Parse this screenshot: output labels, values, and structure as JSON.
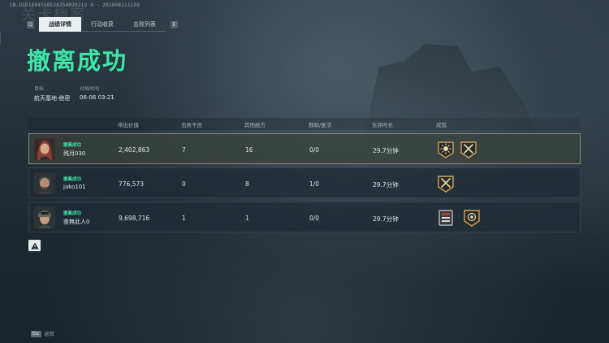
{
  "uid_text": "CN-UID1884558524254020213 4 - 202808111159",
  "ghost_title": "关卡档案",
  "tabs": {
    "left_key": "Q",
    "right_key": "E",
    "items": [
      {
        "label": "战绩详情",
        "active": true
      },
      {
        "label": "行动收获",
        "active": false
      },
      {
        "label": "击败列表",
        "active": false
      }
    ]
  },
  "result_title": "撤离成功",
  "meta": {
    "target_label": "目标",
    "target_value": "航天基地-绝密",
    "time_label": "对局时间",
    "time_value": "06-06 03:21"
  },
  "table": {
    "headers": [
      "带出价值",
      "击败干员",
      "其他敌方",
      "救助/复活",
      "生存时长",
      "成就"
    ],
    "rows": [
      {
        "status": "撤离成功",
        "name": "残月030",
        "value": "2,402,863",
        "kills": "7",
        "other": "16",
        "assist": "0/0",
        "time": "29.7分钟",
        "achievements": [
          "sunburst-badge-icon",
          "crossed-weapons-badge-icon"
        ],
        "highlight": true,
        "avatar": "female-operator"
      },
      {
        "status": "撤离成功",
        "name": "jako101",
        "value": "776,573",
        "kills": "0",
        "other": "8",
        "assist": "1/0",
        "time": "29.7分钟",
        "achievements": [
          "crossed-weapons-badge-icon"
        ],
        "highlight": false,
        "avatar": "bearded-operator"
      },
      {
        "status": "撤离成功",
        "name": "查無此人0",
        "value": "9,698,716",
        "kills": "1",
        "other": "1",
        "assist": "0/0",
        "time": "29.7分钟",
        "achievements": [
          "safe-box-icon",
          "shield-star-badge-icon"
        ],
        "highlight": false,
        "avatar": "helmet-operator"
      }
    ]
  },
  "footer": {
    "key": "Esc",
    "label": "返回"
  },
  "colors": {
    "accent": "#3ee6a8",
    "badge_gold": "#c9a45a"
  }
}
